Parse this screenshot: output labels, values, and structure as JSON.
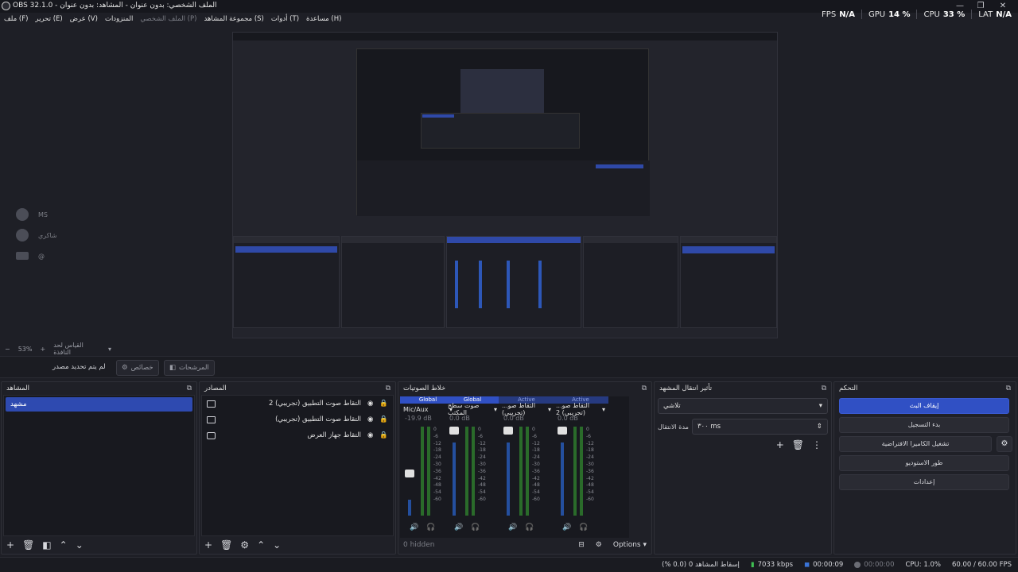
{
  "window": {
    "title": "OBS 32.1.0 - الملف الشخصي: بدون عنوان - المشاهد: بدون عنوان"
  },
  "menu": [
    "ملف (F)",
    "تحرير (E)",
    "عرض (V)",
    "المنزودات",
    "الملف الشخصي (P)",
    "مجموعة المشاهد (S)",
    "أدوات (T)",
    "مساعدة (H)"
  ],
  "stats": [
    {
      "label": "FPS",
      "value": "N/A"
    },
    {
      "label": "GPU",
      "value": "14 %"
    },
    {
      "label": "CPU",
      "value": "33 %"
    },
    {
      "label": "LAT",
      "value": "N/A"
    }
  ],
  "preview_zoom": {
    "minus": "−",
    "value": "53%",
    "plus": "+",
    "fit": "القياس لحد النافذة"
  },
  "toolbar": {
    "no_source": "لم يتم تحديد مصدر",
    "properties": "خصائص",
    "filters": "المرشحات"
  },
  "left_list": [
    {
      "label": "MS"
    },
    {
      "label": "شاكري"
    },
    {
      "label": "@"
    }
  ],
  "docks": {
    "scenes": {
      "title": "المشاهد",
      "items": [
        "مشهد"
      ]
    },
    "sources": {
      "title": "المصادر",
      "items": [
        {
          "name": "التقاط صوت التطبيق (تجريبي) 2",
          "icon": "speaker-icon"
        },
        {
          "name": "التقاط صوت التطبيق (تجريبي)",
          "icon": "speaker-icon"
        },
        {
          "name": "التقاط جهاز العرض",
          "icon": "display-icon"
        }
      ]
    },
    "mixer": {
      "title": "خلاط الصوتيات",
      "channels": [
        {
          "head": "Global",
          "name": "Mic/Aux",
          "db": "-19.9 dB",
          "level": 0.18
        },
        {
          "head": "Global",
          "name": "صوت سطح المكتب",
          "db": "0.0 dB",
          "level": 0.82
        },
        {
          "head": "Active",
          "name": "التقاط صو... (تجريبي)",
          "db": "0.0 dB",
          "level": 0.82
        },
        {
          "head": "Active",
          "name": "التقاط صو... (تجريبي) 2",
          "db": "0.0 dB",
          "level": 0.82
        }
      ],
      "scale": [
        "0",
        "-6",
        "-12",
        "-18",
        "-24",
        "-30",
        "-36",
        "-42",
        "-48",
        "-54",
        "-60"
      ],
      "hidden": "0 hidden",
      "options": "Options"
    },
    "transitions": {
      "title": "تأثير انتقال المشهد",
      "type": "تلاشي",
      "duration_label": "مدة الانتقال",
      "duration": "٣٠٠ ms"
    },
    "controls": {
      "title": "التحكم",
      "buttons": [
        "إيقاف البث",
        "بدء التسجيل",
        "تشغيل الكاميرا الافتراضية",
        "طور الاستوديو",
        "إعدادات"
      ]
    }
  },
  "status": {
    "dropped": "إسقاط المشاهد 0 (0.0 %)",
    "bitrate": "7033 kbps",
    "stream_time": "00:00:09",
    "rec_time": "00:00:00",
    "cpu": "CPU: 1.0%",
    "fps": "60.00 / 60.00 FPS"
  },
  "colors": {
    "accent": "#3050c4",
    "stream": "#3a73d6",
    "bitrate": "#3fbf52"
  }
}
